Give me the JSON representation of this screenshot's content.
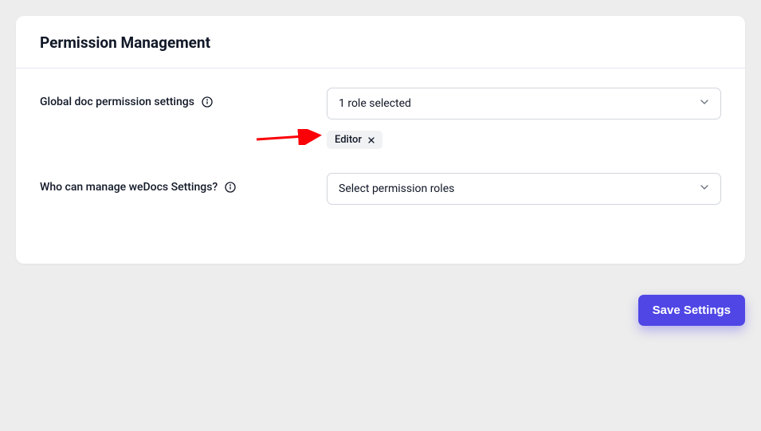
{
  "section": {
    "title": "Permission Management"
  },
  "rows": {
    "global": {
      "label": "Global doc permission settings",
      "select_text": "1 role selected",
      "chip_label": "Editor"
    },
    "manage": {
      "label": "Who can manage weDocs Settings?",
      "select_text": "Select permission roles"
    }
  },
  "actions": {
    "save": "Save Settings"
  },
  "colors": {
    "accent": "#4f46e5",
    "annotation": "#fb0007"
  }
}
